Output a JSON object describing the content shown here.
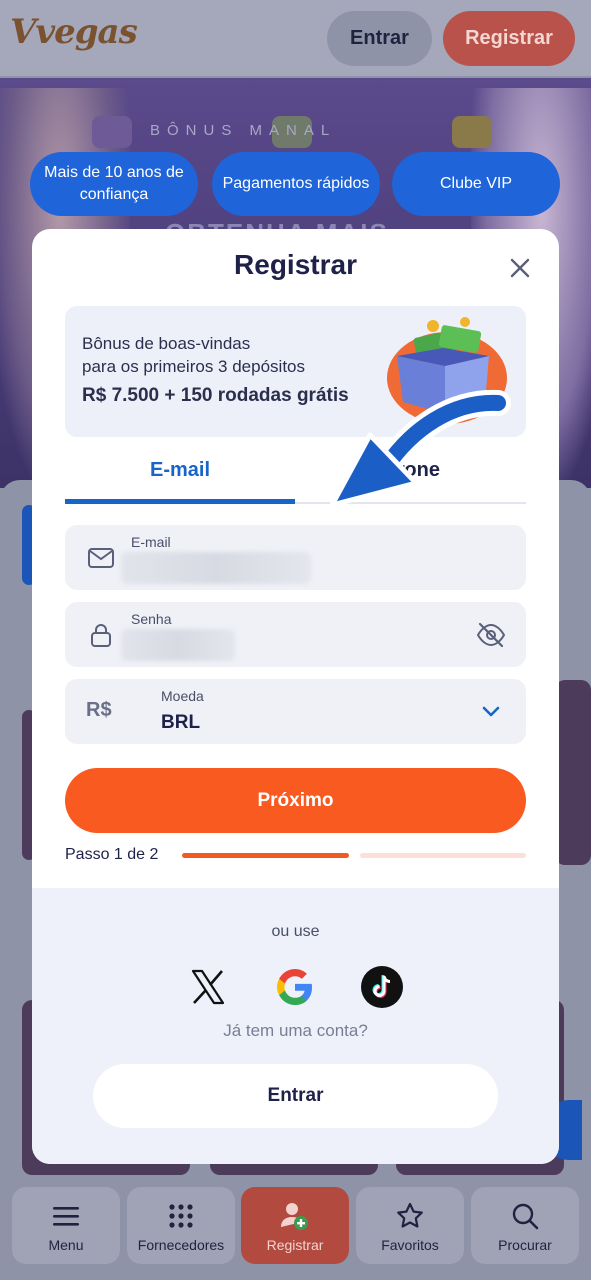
{
  "header": {
    "logo": "Vvegas",
    "login_label": "Entrar",
    "register_label": "Registrar"
  },
  "banner": {
    "kicker": "BÔNUS MANAL",
    "headline": "OBTENHA MAIS"
  },
  "pills": [
    {
      "label": "Mais de 10 anos de confiança"
    },
    {
      "label": "Pagamentos rápidos"
    },
    {
      "label": "Clube VIP"
    }
  ],
  "modal": {
    "title": "Registrar",
    "promo": {
      "line1": "Bônus de boas-vindas",
      "line2": "para os primeiros 3 depósitos",
      "line3": "R$ 7.500 + 150 rodadas grátis"
    },
    "tabs": [
      {
        "label": "E-mail",
        "active": true
      },
      {
        "label": "lefone",
        "active": false
      }
    ],
    "fields": {
      "email": {
        "label": "E-mail",
        "icon": "envelope-icon"
      },
      "password": {
        "label": "Senha",
        "icon": "lock-icon"
      },
      "currency": {
        "symbol": "R$",
        "label": "Moeda",
        "value": "BRL"
      }
    },
    "next_label": "Próximo",
    "step": {
      "label": "Passo 1 de 2",
      "current": 1,
      "total": 2
    },
    "footer": {
      "or_use": "ou use",
      "social": [
        "x-icon",
        "google-icon",
        "tiktok-icon"
      ],
      "have_account": "Já tem uma conta?",
      "login_label": "Entrar"
    }
  },
  "bottom_nav": [
    {
      "label": "Menu",
      "icon": "menu-icon"
    },
    {
      "label": "Fornecedores",
      "icon": "grid-icon"
    },
    {
      "label": "Registrar",
      "icon": "add-user-icon",
      "active": true
    },
    {
      "label": "Favoritos",
      "icon": "star-icon"
    },
    {
      "label": "Procurar",
      "icon": "search-icon"
    }
  ],
  "colors": {
    "accent_orange": "#f85a20",
    "accent_blue": "#1765c8",
    "title_navy": "#1e2249"
  }
}
